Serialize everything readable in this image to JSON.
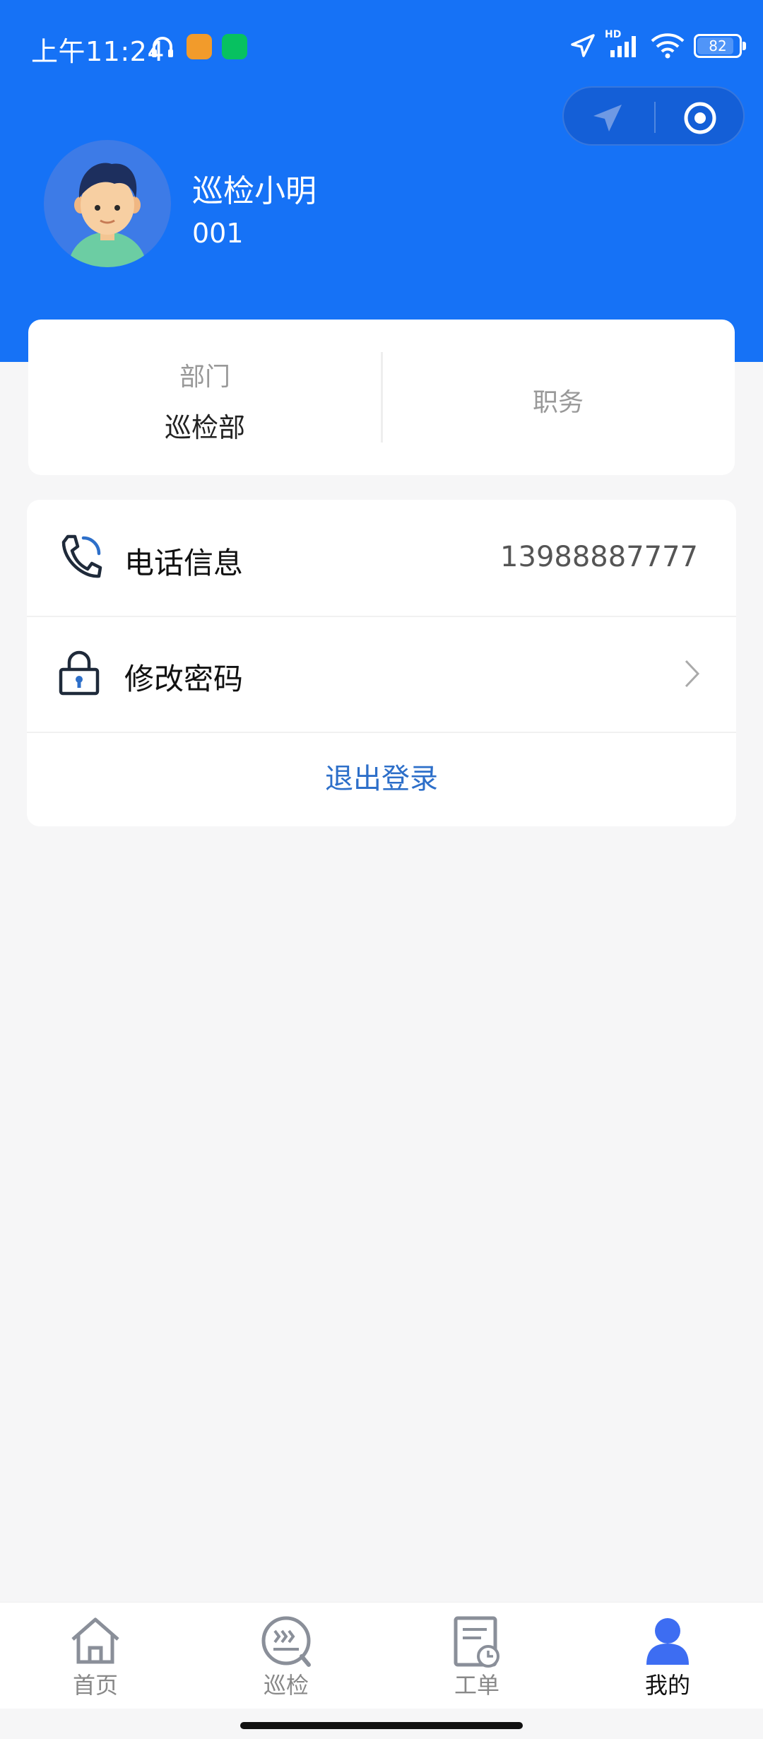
{
  "status_bar": {
    "time": "上午11:24",
    "battery": "82",
    "network": "HD"
  },
  "profile": {
    "name": "巡检小明",
    "id": "001"
  },
  "info_card": {
    "dept_label": "部门",
    "dept_value": "巡检部",
    "job_label": "职务"
  },
  "actions": {
    "phone_label": "电话信息",
    "phone_value": "13988887777",
    "password_label": "修改密码",
    "logout_label": "退出登录"
  },
  "tabbar": {
    "items": [
      {
        "label": "首页",
        "icon": "home-icon"
      },
      {
        "label": "巡检",
        "icon": "inspection-icon"
      },
      {
        "label": "工单",
        "icon": "work-order-icon"
      },
      {
        "label": "我的",
        "icon": "profile-icon",
        "active": true
      }
    ]
  },
  "colors": {
    "primary": "#1672f6",
    "link": "#2d6fc9",
    "background": "#f6f6f7"
  }
}
